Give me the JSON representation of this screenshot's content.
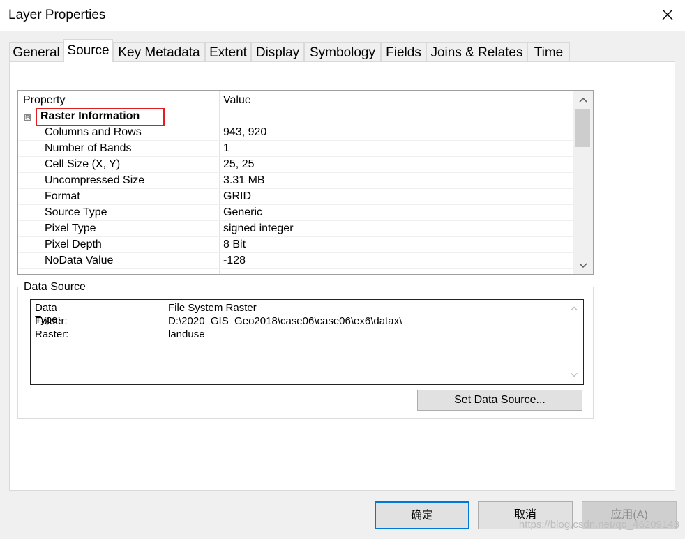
{
  "window": {
    "title": "Layer Properties"
  },
  "tabs": [
    {
      "label": "General"
    },
    {
      "label": "Source",
      "active": true
    },
    {
      "label": "Key Metadata"
    },
    {
      "label": "Extent"
    },
    {
      "label": "Display"
    },
    {
      "label": "Symbology"
    },
    {
      "label": "Fields"
    },
    {
      "label": "Joins & Relates"
    },
    {
      "label": "Time"
    }
  ],
  "grid": {
    "header_property": "Property",
    "header_value": "Value",
    "group_label": "Raster Information",
    "group_expander": "⊟",
    "rows": [
      {
        "property": "Columns and Rows",
        "value": "943, 920"
      },
      {
        "property": "Number of Bands",
        "value": "1"
      },
      {
        "property": "Cell Size (X, Y)",
        "value": "25, 25"
      },
      {
        "property": "Uncompressed Size",
        "value": "3.31 MB"
      },
      {
        "property": "Format",
        "value": "GRID"
      },
      {
        "property": "Source Type",
        "value": "Generic"
      },
      {
        "property": "Pixel Type",
        "value": "signed integer"
      },
      {
        "property": "Pixel Depth",
        "value": "8 Bit"
      },
      {
        "property": "NoData Value",
        "value": "-128"
      }
    ]
  },
  "data_source": {
    "label": "Data Source",
    "rows": [
      {
        "key": "Data Type:",
        "value": "File System Raster"
      },
      {
        "key": "Folder:",
        "value": "D:\\2020_GIS_Geo2018\\case06\\case06\\ex6\\datax\\"
      },
      {
        "key": "Raster:",
        "value": "landuse"
      }
    ],
    "set_button": "Set Data Source..."
  },
  "footer": {
    "ok": "确定",
    "cancel": "取消",
    "apply": "应用(A)"
  },
  "watermark": "https://blog.csdn.net/qq_46209143",
  "colors": {
    "highlight": "#e02020",
    "focus": "#0078d7"
  }
}
